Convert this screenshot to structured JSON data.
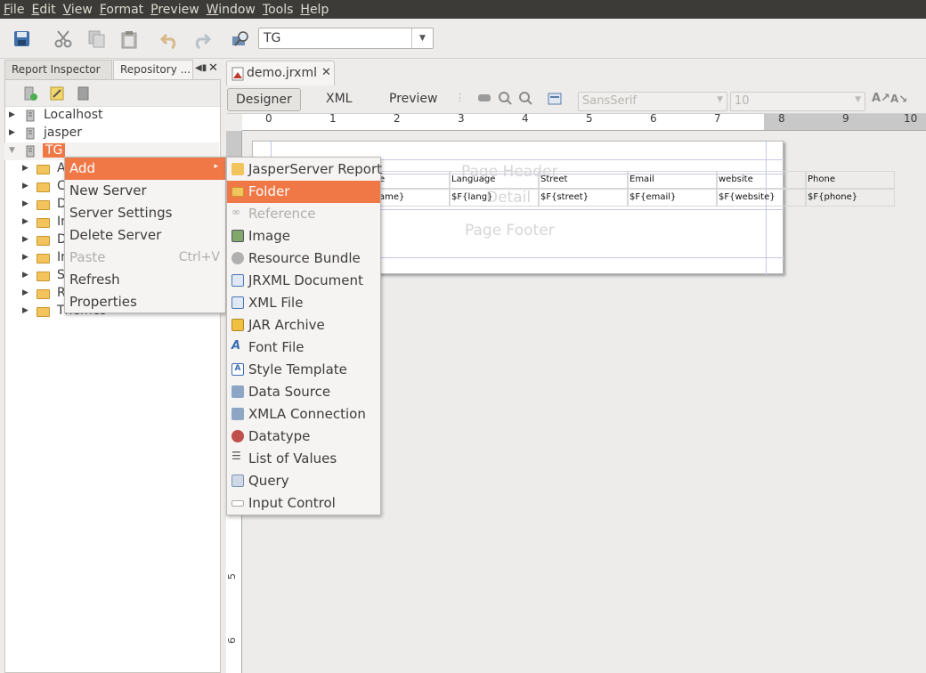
{
  "menubar": [
    "File",
    "Edit",
    "View",
    "Format",
    "Preview",
    "Window",
    "Tools",
    "Help"
  ],
  "toolbar": {
    "combo_value": "TG"
  },
  "left_tabs": [
    "Report Inspector",
    "Repository ..."
  ],
  "tree": {
    "servers": [
      "Localhost",
      "jasper",
      "TG"
    ],
    "tg_children": [
      "A",
      "C",
      "D",
      "In",
      "D",
      "In",
      "S",
      "R",
      "Themes"
    ]
  },
  "doc_tab": {
    "title": "demo.jrxml"
  },
  "designer": {
    "tabs": [
      "Designer",
      "XML",
      "Preview"
    ],
    "font": "SansSerif",
    "size": "10"
  },
  "ruler": [
    "0",
    "1",
    "2",
    "3",
    "4",
    "5",
    "6",
    "7",
    "8",
    "9",
    "10"
  ],
  "vruler": [
    "5",
    "6"
  ],
  "report": {
    "page_header": "Page Header",
    "detail": "Detail",
    "page_footer": "Page Footer",
    "headers": [
      "e",
      "Language",
      "Street",
      "Email",
      "website",
      "Phone"
    ],
    "fields": [
      "ame}",
      "$F{lang}",
      "$F{street}",
      "$F{email}",
      "$F{website}",
      "$F{phone}"
    ]
  },
  "context_menu": {
    "items": [
      "Add",
      "New Server",
      "Server Settings",
      "Delete Server",
      "Paste",
      "Refresh",
      "Properties"
    ],
    "paste_shortcut": "Ctrl+V"
  },
  "submenu": {
    "items": [
      "JasperServer Report",
      "Folder",
      "Reference",
      "Image",
      "Resource Bundle",
      "JRXML Document",
      "XML File",
      "JAR Archive",
      "Font File",
      "Style Template",
      "Data Source",
      "XMLA Connection",
      "Datatype",
      "List of Values",
      "Query",
      "Input Control"
    ]
  },
  "colors": {
    "highlight": "#f07746",
    "menubar_bg": "#3c3b37"
  }
}
